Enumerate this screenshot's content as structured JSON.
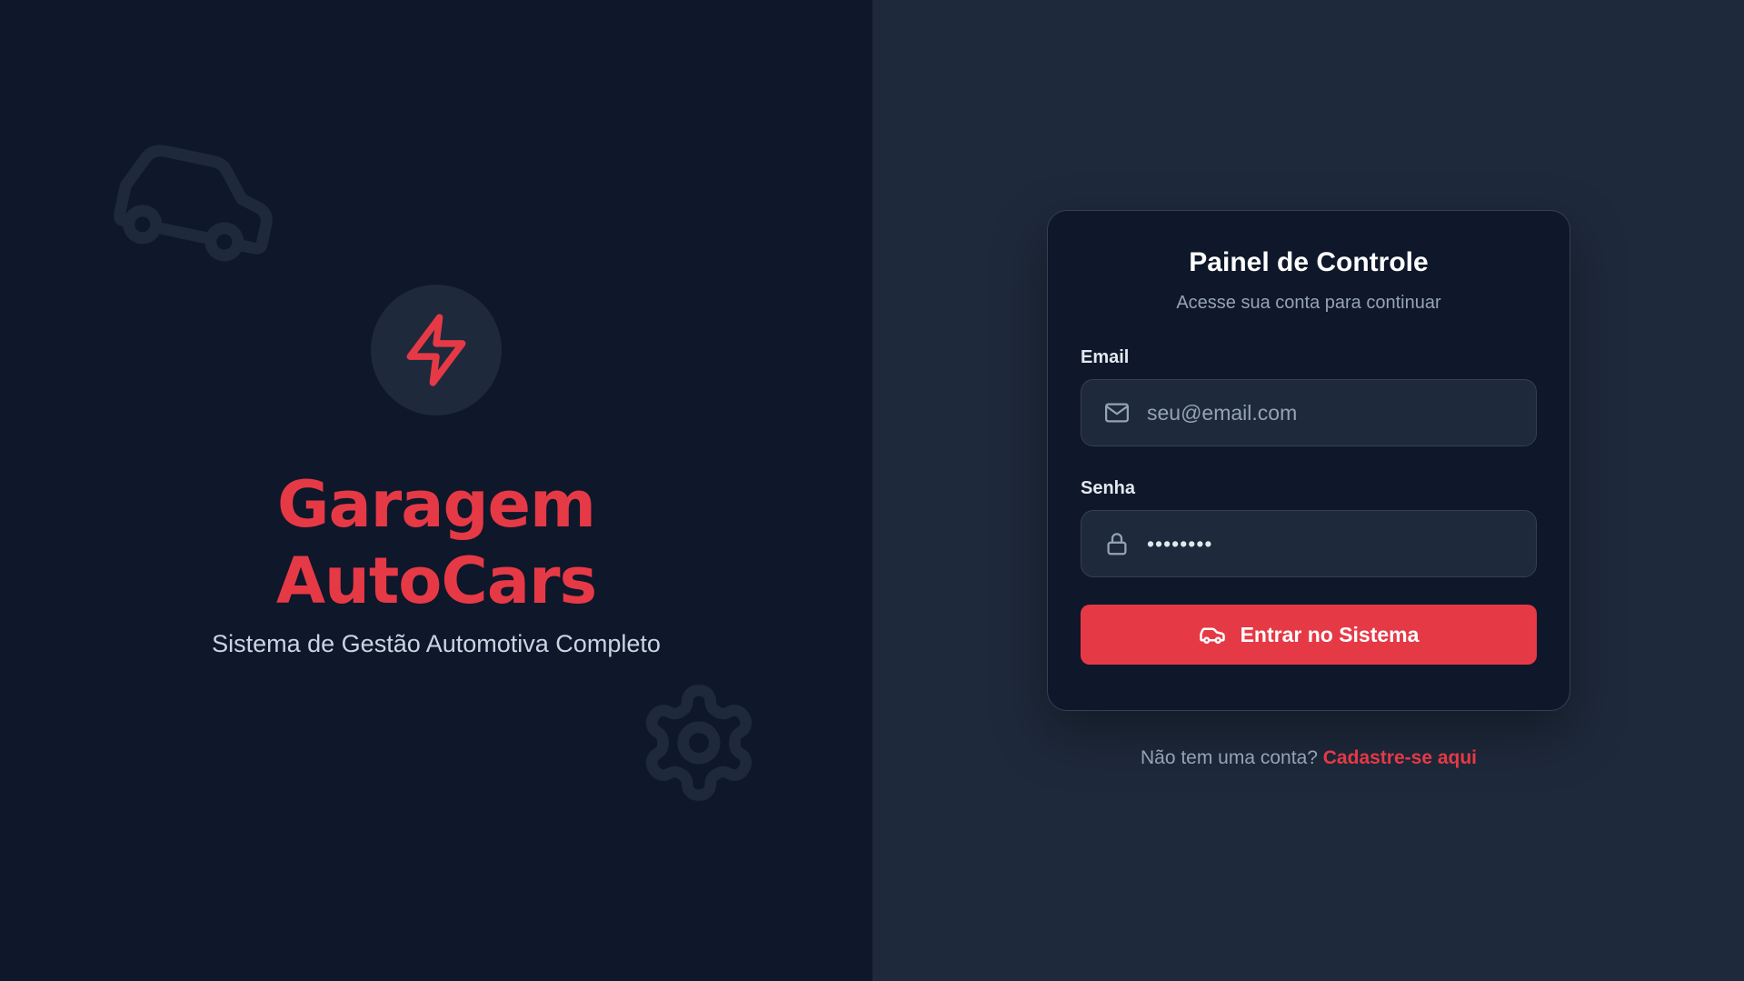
{
  "brand": {
    "title_line1": "Garagem",
    "title_line2": "AutoCars",
    "subtitle": "Sistema de Gestão Automotiva Completo",
    "logo_icon": "lightning-bolt-icon"
  },
  "decorations": {
    "car_icon": "car-icon",
    "gear_icon": "gear-icon"
  },
  "login": {
    "title": "Painel de Controle",
    "subtitle": "Acesse sua conta para continuar",
    "email_label": "Email",
    "email_placeholder": "seu@email.com",
    "email_icon": "mail-icon",
    "password_label": "Senha",
    "password_value": "••••••••",
    "password_icon": "lock-icon",
    "submit_label": "Entrar no Sistema",
    "submit_icon": "car-icon"
  },
  "signup": {
    "prompt": "Não tem uma conta?",
    "link_label": "Cadastre-se aqui"
  },
  "colors": {
    "accent": "#e63946",
    "left_background": "#0f172a",
    "right_background": "#1e293b",
    "card_background": "#0f172a",
    "input_background": "#1e293b",
    "muted_text": "#94a3b8"
  }
}
